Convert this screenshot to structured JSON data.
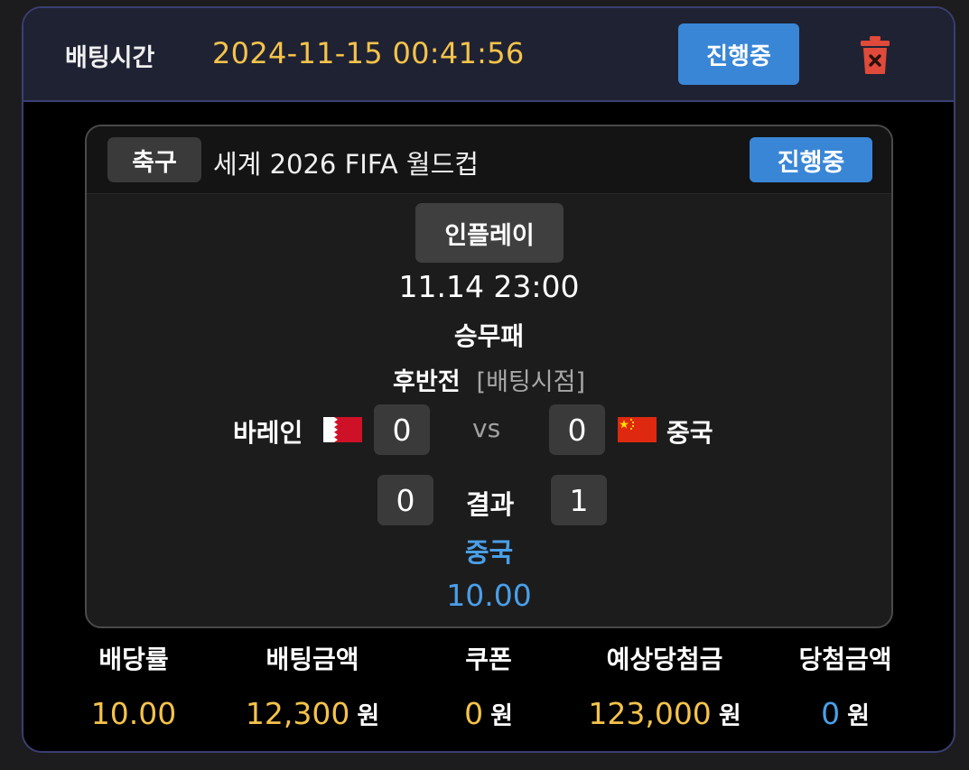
{
  "header": {
    "label": "배팅시간",
    "time": "2024-11-15 00:41:56",
    "status": "진행중"
  },
  "match": {
    "sport": "축구",
    "league": "세계 2026 FIFA 월드컵",
    "status": "진행중",
    "inplay": "인플레이",
    "datetime": "11.14 23:00",
    "market": "승무패",
    "period": "후반전",
    "bet_time_note": "[배팅시점]",
    "home_team": "바레인",
    "away_team": "중국",
    "home_score": "0",
    "away_score": "0",
    "vs": "vs",
    "result_label": "결과",
    "result_home": "0",
    "result_away": "1",
    "pick": "중국",
    "pick_odds": "10.00"
  },
  "stats": {
    "odds_label": "배당률",
    "odds_value": "10.00",
    "bet_amount_label": "배팅금액",
    "bet_amount_value": "12,300",
    "coupon_label": "쿠폰",
    "coupon_value": "0",
    "expected_label": "예상당첨금",
    "expected_value": "123,000",
    "win_label": "당첨금액",
    "win_value": "0",
    "currency": "원"
  },
  "colors": {
    "accent_blue": "#3a86d6",
    "gold": "#f5c34a",
    "pick_blue": "#4a9fe8",
    "delete_red": "#e04a3a"
  },
  "icons": {
    "delete": "trash-icon",
    "home_flag": "bahrain-flag-icon",
    "away_flag": "china-flag-icon"
  }
}
